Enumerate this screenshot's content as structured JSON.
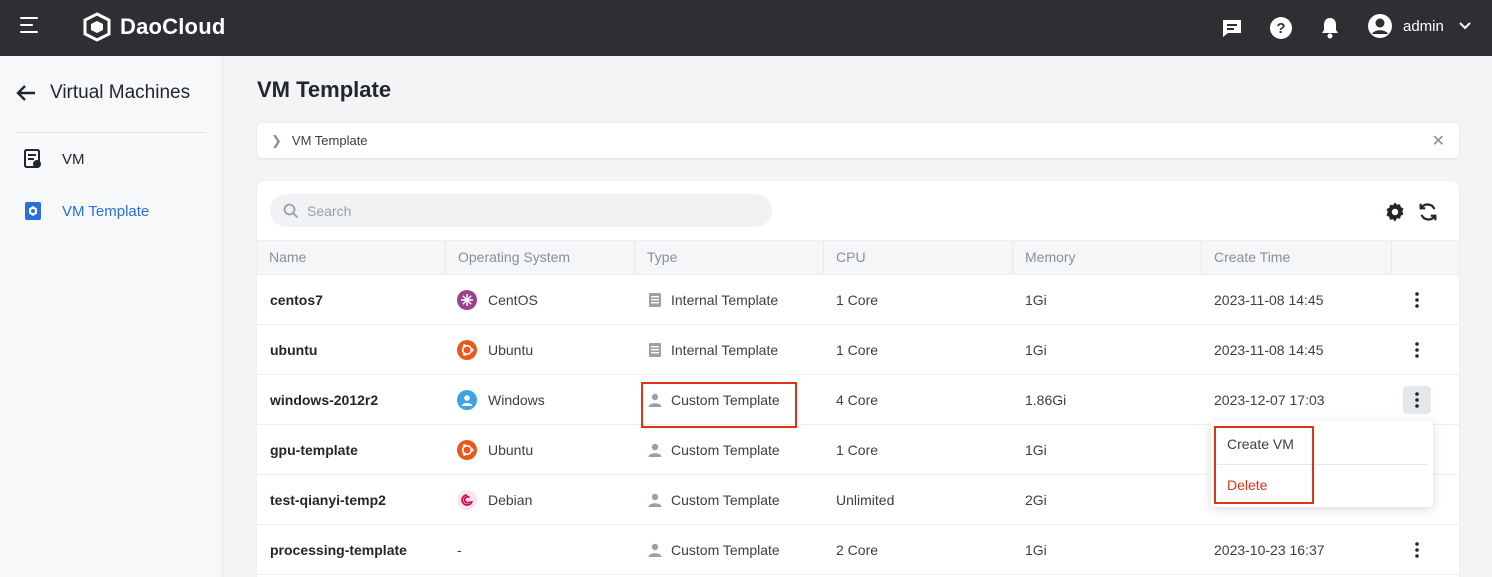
{
  "topbar": {
    "brand": "DaoCloud",
    "user": "admin",
    "icons": [
      "menu-icon",
      "message-icon",
      "help-icon",
      "bell-icon",
      "user-icon",
      "chevron-down-icon"
    ]
  },
  "sidebar": {
    "back_title": "Virtual Machines",
    "items": [
      {
        "label": "VM",
        "icon": "vm-icon",
        "active": false
      },
      {
        "label": "VM Template",
        "icon": "template-icon",
        "active": true
      }
    ]
  },
  "page": {
    "title": "VM Template",
    "breadcrumb": "VM Template"
  },
  "search": {
    "placeholder": "Search"
  },
  "table": {
    "columns": [
      "Name",
      "Operating System",
      "Type",
      "CPU",
      "Memory",
      "Create Time"
    ],
    "rows": [
      {
        "name": "centos7",
        "os": "CentOS",
        "os_icon": "centos-icon",
        "type": "Internal Template",
        "type_icon": "document-icon",
        "cpu": "1 Core",
        "memory": "1Gi",
        "created": "2023-11-08 14:45"
      },
      {
        "name": "ubuntu",
        "os": "Ubuntu",
        "os_icon": "ubuntu-icon",
        "type": "Internal Template",
        "type_icon": "document-icon",
        "cpu": "1 Core",
        "memory": "1Gi",
        "created": "2023-11-08 14:45"
      },
      {
        "name": "windows-2012r2",
        "os": "Windows",
        "os_icon": "windows-user-icon",
        "type": "Custom Template",
        "type_icon": "person-icon",
        "cpu": "4 Core",
        "memory": "1.86Gi",
        "created": "2023-12-07 17:03"
      },
      {
        "name": "gpu-template",
        "os": "Ubuntu",
        "os_icon": "ubuntu-icon",
        "type": "Custom Template",
        "type_icon": "person-icon",
        "cpu": "1 Core",
        "memory": "1Gi",
        "created": ""
      },
      {
        "name": "test-qianyi-temp2",
        "os": "Debian",
        "os_icon": "debian-icon",
        "type": "Custom Template",
        "type_icon": "person-icon",
        "cpu": "Unlimited",
        "memory": "2Gi",
        "created": ""
      },
      {
        "name": "processing-template",
        "os": "-",
        "os_icon": "",
        "type": "Custom Template",
        "type_icon": "person-icon",
        "cpu": "2 Core",
        "memory": "1Gi",
        "created": "2023-10-23 16:37"
      }
    ]
  },
  "dropdown": {
    "create_vm": "Create VM",
    "delete": "Delete"
  },
  "colors": {
    "topbar": "#2d2f33",
    "accent": "#2a6fdb",
    "danger": "#e0311b"
  }
}
